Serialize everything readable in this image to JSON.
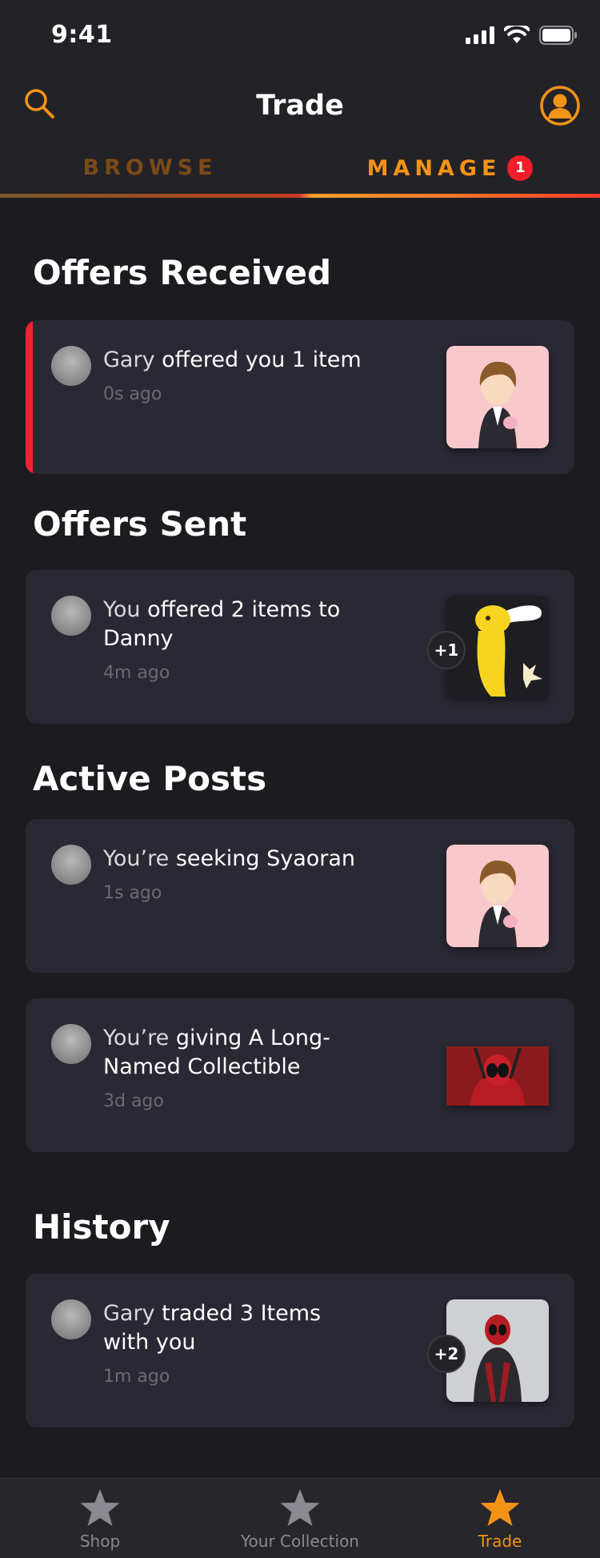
{
  "status": {
    "time": "9:41"
  },
  "header": {
    "title": "Trade"
  },
  "tabs": {
    "browse": "BROWSE",
    "manage": "MANAGE",
    "manage_badge": "1"
  },
  "sections": {
    "offers_received": "Offers Received",
    "offers_sent": "Offers Sent",
    "active_posts": "Active Posts",
    "history": "History"
  },
  "cards": [
    {
      "actor": "Gary",
      "action": " offered you 1 item",
      "time": "0s ago"
    },
    {
      "actor": "You",
      "action": " offered 2 items to Danny",
      "time": "4m ago",
      "badge": "+1"
    },
    {
      "actor": "You’re",
      "action": " seeking Syaoran",
      "time": "1s ago"
    },
    {
      "actor": "You’re",
      "action": " giving A Long-Named Collectible",
      "time": "3d ago"
    },
    {
      "actor": "Gary",
      "action": " traded 3 Items with you",
      "time": "1m ago",
      "badge": "+2"
    }
  ],
  "tabbar": {
    "shop": "Shop",
    "collection": "Your Collection",
    "trade": "Trade"
  },
  "colors": {
    "accent": "#f39317",
    "alert": "#ee2330",
    "card": "#2a2933",
    "background": "#1c1b20"
  }
}
